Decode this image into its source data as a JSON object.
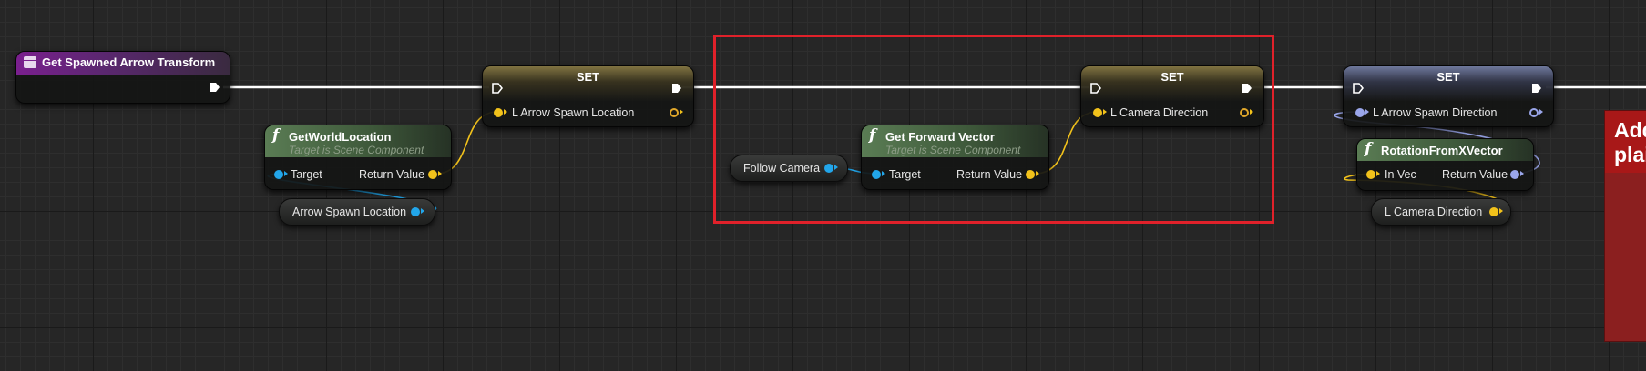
{
  "graph": {
    "event_node": {
      "title": "Get Spawned Arrow Transform"
    },
    "set_node_1": {
      "title": "SET",
      "var": "L Arrow Spawn Location"
    },
    "get_world_location": {
      "title": "GetWorldLocation",
      "subtitle": "Target is Scene Component",
      "input": "Target",
      "output": "Return Value"
    },
    "arrow_spawn_location_getter": {
      "label": "Arrow Spawn Location"
    },
    "follow_camera_getter": {
      "label": "Follow Camera"
    },
    "get_forward_vector": {
      "title": "Get Forward Vector",
      "subtitle": "Target is Scene Component",
      "input": "Target",
      "output": "Return Value"
    },
    "set_node_2": {
      "title": "SET",
      "var": "L Camera Direction"
    },
    "set_node_3": {
      "title": "SET",
      "var": "L Arrow Spawn Direction"
    },
    "rotation_from_x_vector": {
      "title": "RotationFromXVector",
      "input": "In Vec",
      "output": "Return Value"
    },
    "camera_direction_getter": {
      "label": "L Camera Direction"
    },
    "comment_box": {
      "title": "Add plai"
    }
  },
  "colors": {
    "exec_wire": "#ffffff",
    "vector_pin": "#f2c21b",
    "object_pin": "#22a6ea",
    "rotator_pin": "#9aa6ea",
    "selection_box": "#e0212a",
    "comment": "#a81818"
  }
}
